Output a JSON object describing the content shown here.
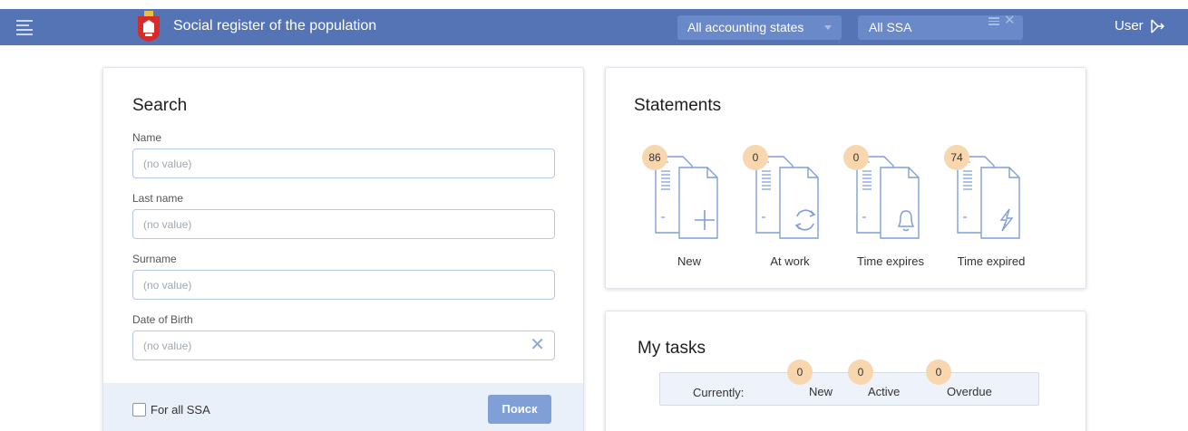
{
  "header": {
    "title": "Social register of the population",
    "state_filter": "All accounting states",
    "ssa_filter": "All SSA",
    "user": "User",
    "bg_color": "#5474b6"
  },
  "search": {
    "title": "Search",
    "fields": [
      {
        "label": "Name",
        "placeholder": "(no value)"
      },
      {
        "label": "Last name",
        "placeholder": "(no value)"
      },
      {
        "label": "Surname",
        "placeholder": "(no value)"
      },
      {
        "label": "Date of Birth",
        "placeholder": "(no value)"
      }
    ],
    "for_all_ssa": "For all SSA",
    "search_button": "Поиск"
  },
  "statements": {
    "title": "Statements",
    "items": [
      {
        "label": "New",
        "count": "86",
        "icon": "plus-icon"
      },
      {
        "label": "At work",
        "count": "0",
        "icon": "refresh-icon"
      },
      {
        "label": "Time expires",
        "count": "0",
        "icon": "bell-icon"
      },
      {
        "label": "Time expired",
        "count": "74",
        "icon": "lightning-icon"
      }
    ]
  },
  "tasks": {
    "title": "My tasks",
    "currently": "Currently:",
    "items": [
      {
        "label": "New",
        "count": "0"
      },
      {
        "label": "Active",
        "count": "0"
      },
      {
        "label": "Overdue",
        "count": "0"
      }
    ]
  },
  "colors": {
    "accent": "#5474b6",
    "badge": "#f9d7ae",
    "doc_stroke": "#7f9fd6"
  }
}
